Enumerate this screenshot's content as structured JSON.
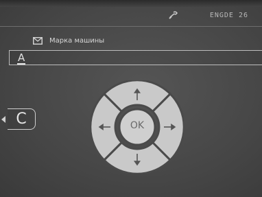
{
  "status": {
    "text": "ENGDE 26",
    "icon": "wrench-icon"
  },
  "field": {
    "icon": "envelope-icon",
    "label": "Марка машины",
    "value": "A"
  },
  "back_button": {
    "label": "C"
  },
  "dpad": {
    "ok_label": "OK",
    "up_icon": "arrow-up",
    "down_icon": "arrow-down",
    "left_icon": "arrow-left",
    "right_icon": "arrow-right"
  },
  "colors": {
    "background": "#4a4a4a",
    "pad": "#c9c9c9",
    "text": "#d8d8d8"
  }
}
